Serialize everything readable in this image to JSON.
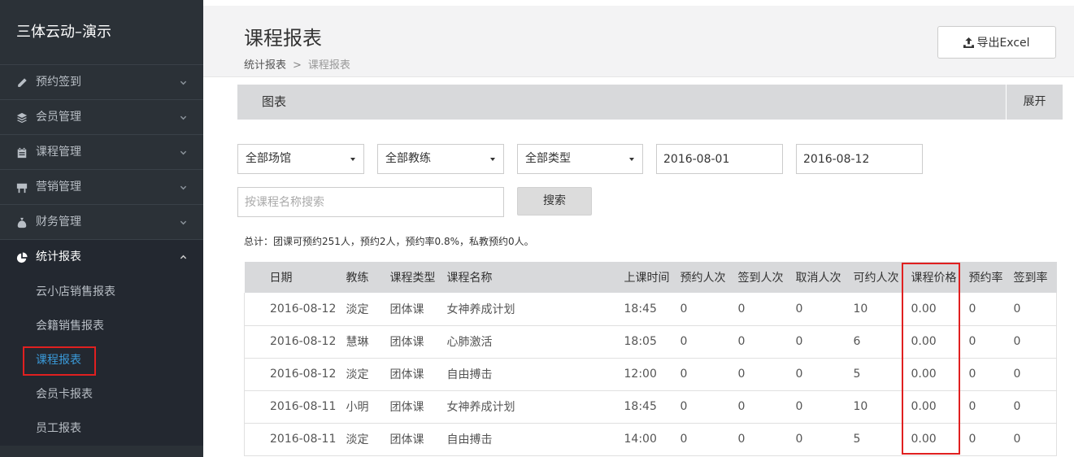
{
  "app": {
    "title": "三体云动–演示"
  },
  "sidebar": {
    "items": [
      {
        "label": "预约签到",
        "icon": "pencil-icon"
      },
      {
        "label": "会员管理",
        "icon": "layers-icon"
      },
      {
        "label": "课程管理",
        "icon": "calendar-icon"
      },
      {
        "label": "营销管理",
        "icon": "signboard-icon"
      },
      {
        "label": "财务管理",
        "icon": "money-bag-icon"
      },
      {
        "label": "统计报表",
        "icon": "pie-chart-icon",
        "active": true
      }
    ],
    "submenu": [
      {
        "label": "云小店销售报表"
      },
      {
        "label": "会籍销售报表"
      },
      {
        "label": "课程报表",
        "current": true
      },
      {
        "label": "会员卡报表"
      },
      {
        "label": "员工报表"
      }
    ]
  },
  "header": {
    "title": "课程报表",
    "breadcrumb": {
      "parent": "统计报表",
      "separator": ">",
      "current": "课程报表"
    },
    "export_label": "导出Excel"
  },
  "chart_panel": {
    "title": "图表",
    "toggle_label": "展开"
  },
  "filters": {
    "venue": "全部场馆",
    "coach": "全部教练",
    "type": "全部类型",
    "start_date": "2016-08-01",
    "end_date": "2016-08-12",
    "search_placeholder": "按课程名称搜索",
    "search_label": "搜索"
  },
  "summary": "总计：团课可预约251人，预约2人，预约率0.8%，私教预约0人。",
  "table": {
    "headers": [
      "日期",
      "教练",
      "课程类型",
      "课程名称",
      "上课时间",
      "预约人次",
      "签到人次",
      "取消人次",
      "可约人次",
      "课程价格",
      "预约率",
      "签到率"
    ],
    "rows": [
      [
        "2016-08-12",
        "淡定",
        "团体课",
        "女神养成计划",
        "18:45",
        "0",
        "0",
        "0",
        "10",
        "0.00",
        "0",
        "0"
      ],
      [
        "2016-08-12",
        "慧琳",
        "团体课",
        "心肺激活",
        "18:05",
        "0",
        "0",
        "0",
        "6",
        "0.00",
        "0",
        "0"
      ],
      [
        "2016-08-12",
        "淡定",
        "团体课",
        "自由搏击",
        "12:00",
        "0",
        "0",
        "0",
        "5",
        "0.00",
        "0",
        "0"
      ],
      [
        "2016-08-11",
        "小明",
        "团体课",
        "女神养成计划",
        "18:45",
        "0",
        "0",
        "0",
        "10",
        "0.00",
        "0",
        "0"
      ],
      [
        "2016-08-11",
        "淡定",
        "团体课",
        "自由搏击",
        "14:00",
        "0",
        "0",
        "0",
        "5",
        "0.00",
        "0",
        "0"
      ]
    ]
  },
  "colors": {
    "sidebar_bg": "#2b3137",
    "accent": "#3a9ad9",
    "highlight": "#e02020"
  }
}
